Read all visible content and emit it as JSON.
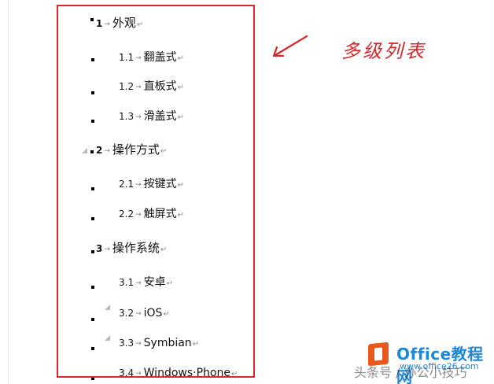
{
  "list": {
    "items": [
      {
        "num": "1",
        "label": "外观",
        "level": 1
      },
      {
        "num": "1.1",
        "label": "翻盖式",
        "level": 2
      },
      {
        "num": "1.2",
        "label": "直板式",
        "level": 2
      },
      {
        "num": "1.3",
        "label": "滑盖式",
        "level": 2
      },
      {
        "num": "2",
        "label": "操作方式",
        "level": 1
      },
      {
        "num": "2.1",
        "label": "按键式",
        "level": 2
      },
      {
        "num": "2.2",
        "label": "触屏式",
        "level": 2
      },
      {
        "num": "3",
        "label": "操作系统",
        "level": 1
      },
      {
        "num": "3.1",
        "label": "安卓",
        "level": 2
      },
      {
        "num": "3.2",
        "label": "iOS",
        "level": 2
      },
      {
        "num": "3.3",
        "label": "Symbian",
        "level": 2
      },
      {
        "num": "3.4",
        "label": "Windows·Phone",
        "level": 2
      }
    ],
    "tab_mark": "→",
    "paragraph_mark": "↵"
  },
  "annotation": {
    "text": "多级列表",
    "color": "#d62728"
  },
  "watermark": {
    "brand": "Office教程网",
    "site": "www.office26.com",
    "overlay": "头条号 / 办公小技巧"
  },
  "colors": {
    "frame": "#e0242b",
    "watermark_blue": "#1e88d8",
    "logo_orange": "#e8581c"
  }
}
